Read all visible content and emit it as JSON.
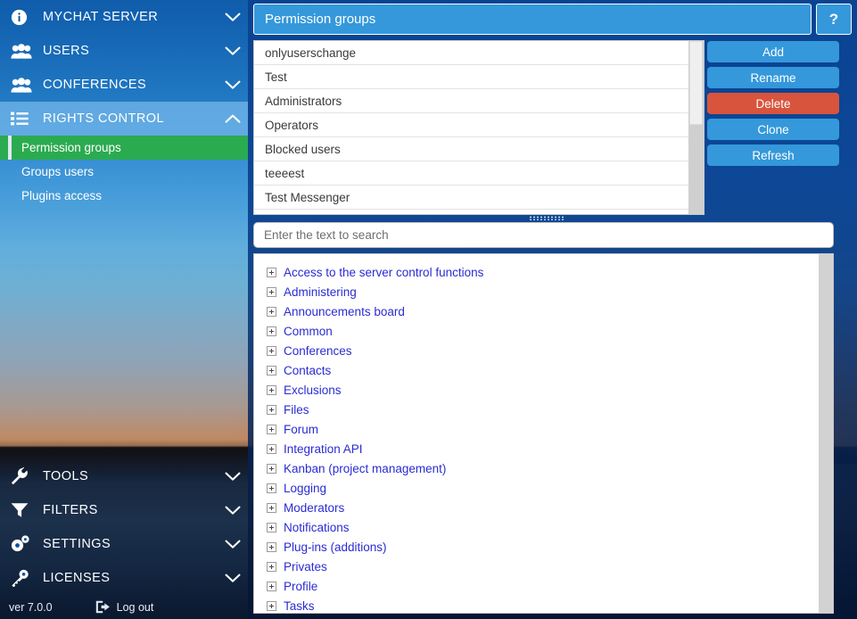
{
  "sidebar": {
    "top_groups": [
      {
        "label": "MYCHAT SERVER",
        "icon": "info-icon",
        "chevron": "chevron-down-icon",
        "active": false
      },
      {
        "label": "USERS",
        "icon": "users-icon",
        "chevron": "chevron-down-icon",
        "active": false
      },
      {
        "label": "CONFERENCES",
        "icon": "users-icon",
        "chevron": "chevron-down-icon",
        "active": false
      },
      {
        "label": "RIGHTS CONTROL",
        "icon": "list-icon",
        "chevron": "chevron-up-icon",
        "active": true
      }
    ],
    "sub_items": [
      {
        "label": "Permission groups",
        "selected": true
      },
      {
        "label": "Groups users",
        "selected": false
      },
      {
        "label": "Plugins access",
        "selected": false
      }
    ],
    "bottom_groups": [
      {
        "label": "TOOLS",
        "icon": "wrench-icon",
        "chevron": "chevron-down-icon"
      },
      {
        "label": "FILTERS",
        "icon": "funnel-icon",
        "chevron": "chevron-down-icon"
      },
      {
        "label": "SETTINGS",
        "icon": "gears-icon",
        "chevron": "chevron-down-icon"
      },
      {
        "label": "LICENSES",
        "icon": "key-icon",
        "chevron": "chevron-down-icon"
      }
    ],
    "footer": {
      "version": "ver 7.0.0",
      "logout_label": "Log out",
      "logout_icon": "logout-icon"
    },
    "colors": {
      "active_group": "#6cb2e8",
      "selected_sub": "#2bab4f"
    }
  },
  "titlebar": {
    "title": "Permission groups",
    "help_label": "?",
    "help_icon": "question-mark-icon"
  },
  "groups_list": {
    "items": [
      "onlyuserschange",
      "Test",
      "Administrators",
      "Operators",
      "Blocked users",
      "teeeest",
      "Test Messenger"
    ]
  },
  "buttons": [
    {
      "label": "Add",
      "name": "add-button",
      "style": "primary"
    },
    {
      "label": "Rename",
      "name": "rename-button",
      "style": "primary"
    },
    {
      "label": "Delete",
      "name": "delete-button",
      "style": "danger"
    },
    {
      "label": "Clone",
      "name": "clone-button",
      "style": "primary"
    },
    {
      "label": "Refresh",
      "name": "refresh-button",
      "style": "primary"
    }
  ],
  "search": {
    "placeholder": "Enter the text to search",
    "value": ""
  },
  "rights_tree": {
    "nodes": [
      "Access to the server control functions",
      "Administering",
      "Announcements board",
      "Common",
      "Conferences",
      "Contacts",
      "Exclusions",
      "Files",
      "Forum",
      "Integration API",
      "Kanban (project management)",
      "Logging",
      "Moderators",
      "Notifications",
      "Plug-ins (additions)",
      "Privates",
      "Profile",
      "Tasks"
    ]
  },
  "colors": {
    "accent_blue": "#3498db",
    "danger_red": "#d9543c",
    "green_selected": "#2bab4f",
    "tree_link": "#2b2bd4"
  }
}
